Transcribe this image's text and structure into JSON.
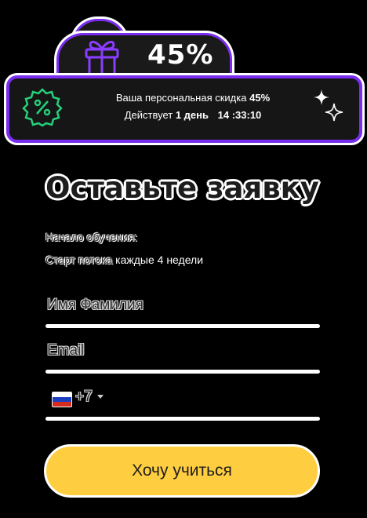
{
  "promo": {
    "discount_big": "45%",
    "line1_text": "Ваша персональная скидка",
    "line1_percent": "45%",
    "line2_text": "Действует",
    "line2_days": "1 день",
    "timer": "14 :33:10",
    "badge_icon": "percent-badge-icon",
    "gift_icon": "gift-icon",
    "sparkle_icon": "sparkle-icon"
  },
  "form": {
    "title": "Оставьте заявку",
    "start_label": "Начало обучения:",
    "start_value": "",
    "stream_label": "Старт потока",
    "stream_value": "каждые 4 недели",
    "name_placeholder": "Имя Фамилия",
    "email_placeholder": "Email",
    "phone_code": "+7",
    "submit_label": "Хочу учиться"
  },
  "colors": {
    "accent_purple": "#7a2df0",
    "button_yellow": "#ffcd40",
    "badge_green": "#24d07a"
  }
}
